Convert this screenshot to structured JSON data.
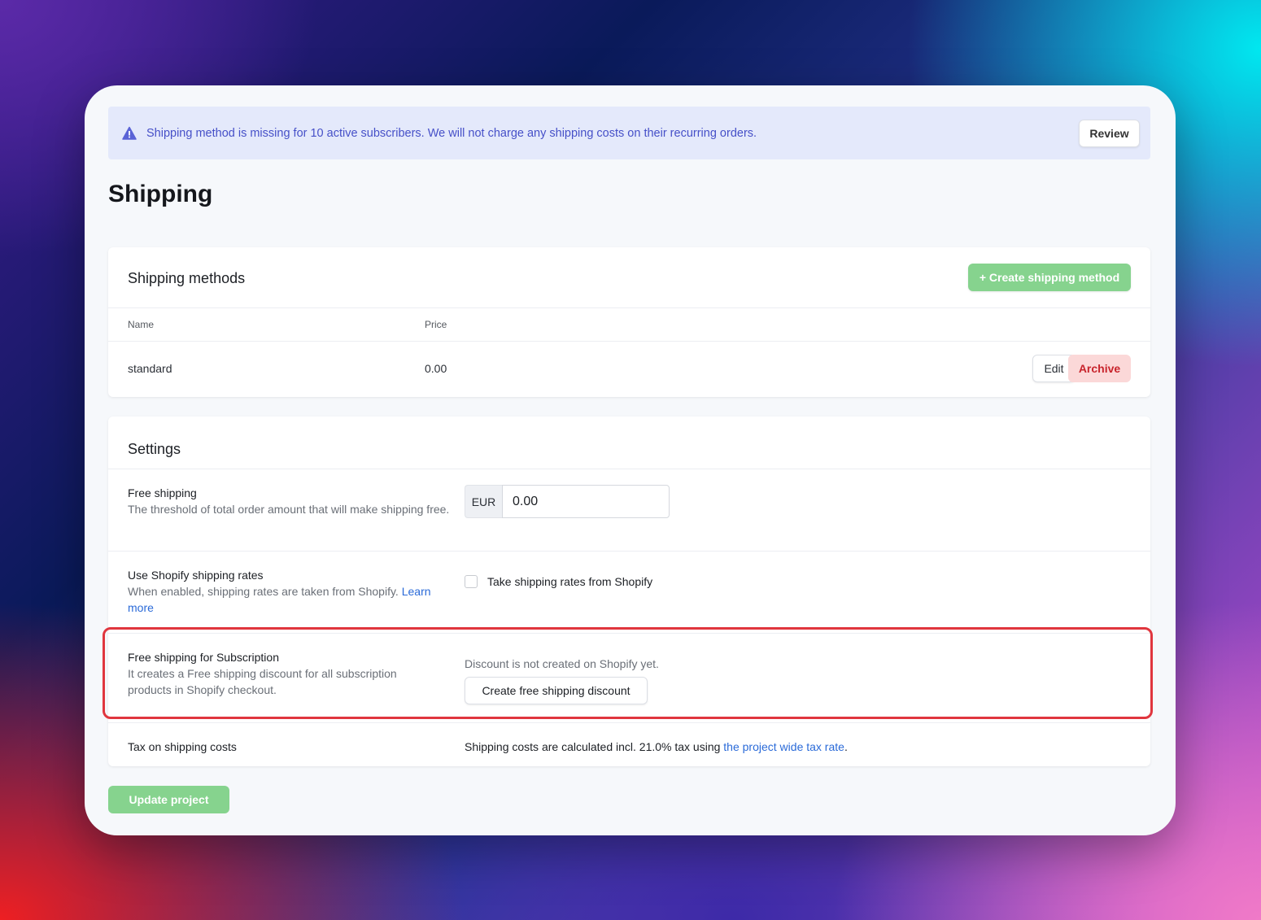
{
  "banner": {
    "icon": "warning-triangle-icon",
    "message": "Shipping method is missing for 10 active subscribers. We will not charge any shipping costs on their recurring orders.",
    "review_label": "Review",
    "color": "#4650c8"
  },
  "page": {
    "title": "Shipping"
  },
  "methods": {
    "title": "Shipping methods",
    "create_label": "+ Create shipping method",
    "columns": [
      "Name",
      "Price"
    ],
    "rows": [
      {
        "name": "standard",
        "price": "0.00",
        "edit_label": "Edit",
        "archive_label": "Archive"
      }
    ]
  },
  "settings": {
    "title": "Settings",
    "free_shipping": {
      "label": "Free shipping",
      "description": "The threshold of total order amount that will make shipping free.",
      "currency": "EUR",
      "value": "0.00"
    },
    "shopify_rates": {
      "label": "Use Shopify shipping rates",
      "description": "When enabled, shipping rates are taken from Shopify.",
      "link": "Learn more",
      "checkbox_label": "Take shipping rates from Shopify",
      "checked": false
    },
    "subscription": {
      "label": "Free shipping for Subscription",
      "description": "It creates a Free shipping discount for all subscription products in Shopify checkout.",
      "status": "Discount is not created on Shopify yet.",
      "button_label": "Create free shipping discount"
    },
    "tax": {
      "label": "Tax on shipping costs",
      "text_prefix": "Shipping costs are calculated incl. 21.0% tax using",
      "link": "the project wide tax rate",
      "suffix": "."
    }
  },
  "footer": {
    "update_label": "Update project"
  },
  "colors": {
    "accent_green": "#86d38e",
    "danger": "#c8242c",
    "highlight": "#e0363e",
    "link": "#2a6ad8"
  }
}
